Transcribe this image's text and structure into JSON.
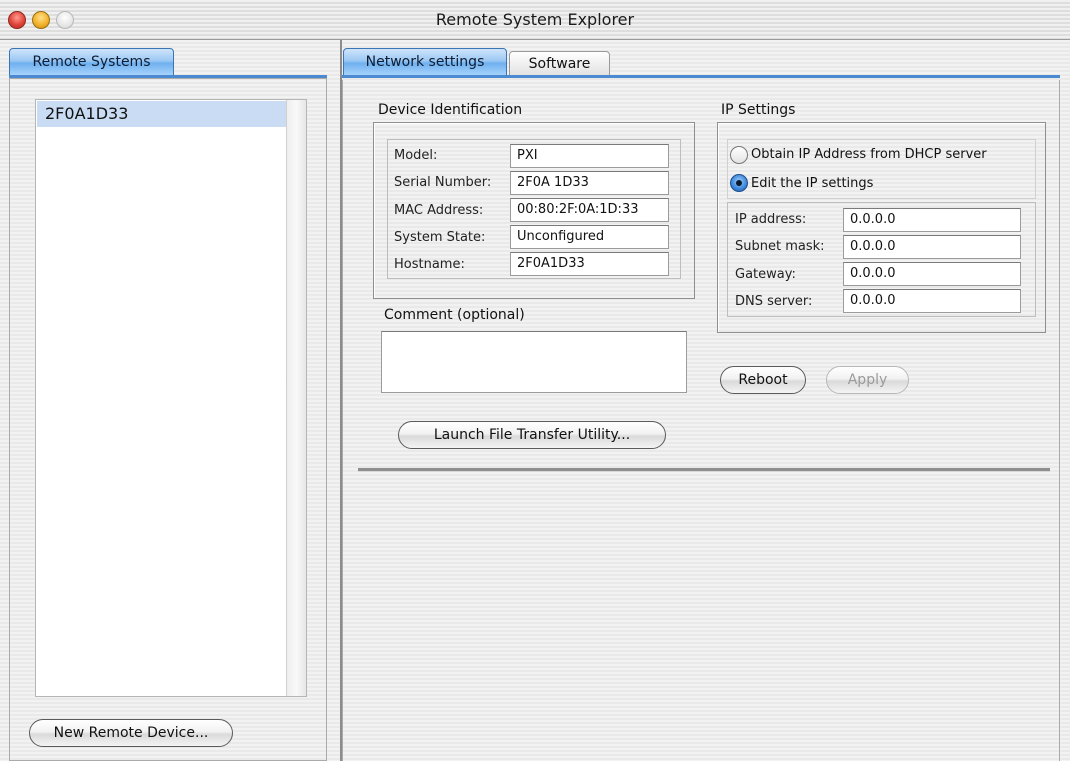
{
  "window": {
    "title": "Remote System Explorer"
  },
  "left_panel": {
    "tab_label": "Remote Systems",
    "items": [
      "2F0A1D33"
    ],
    "new_device_button": "New Remote Device..."
  },
  "tabs": [
    {
      "label": "Network settings",
      "active": true
    },
    {
      "label": "Software",
      "active": false
    }
  ],
  "device_identification": {
    "title": "Device Identification",
    "fields": [
      {
        "label": "Model:",
        "value": "PXI"
      },
      {
        "label": "Serial Number:",
        "value": "2F0A 1D33"
      },
      {
        "label": "MAC Address:",
        "value": "00:80:2F:0A:1D:33"
      },
      {
        "label": "System State:",
        "value": "Unconfigured"
      },
      {
        "label": "Hostname:",
        "value": "2F0A1D33"
      }
    ]
  },
  "comment": {
    "label": "Comment (optional)",
    "value": ""
  },
  "ip_settings": {
    "title": "IP Settings",
    "dhcp_label": "Obtain IP Address from DHCP server",
    "manual_label": "Edit the IP settings",
    "selected": "manual",
    "fields": [
      {
        "label": "IP address:",
        "value": "0.0.0.0"
      },
      {
        "label": "Subnet mask:",
        "value": "0.0.0.0"
      },
      {
        "label": "Gateway:",
        "value": "0.0.0.0"
      },
      {
        "label": "DNS server:",
        "value": "0.0.0.0"
      }
    ]
  },
  "buttons": {
    "reboot": "Reboot",
    "apply": "Apply",
    "launch_ftu": "Launch File Transfer Utility..."
  }
}
